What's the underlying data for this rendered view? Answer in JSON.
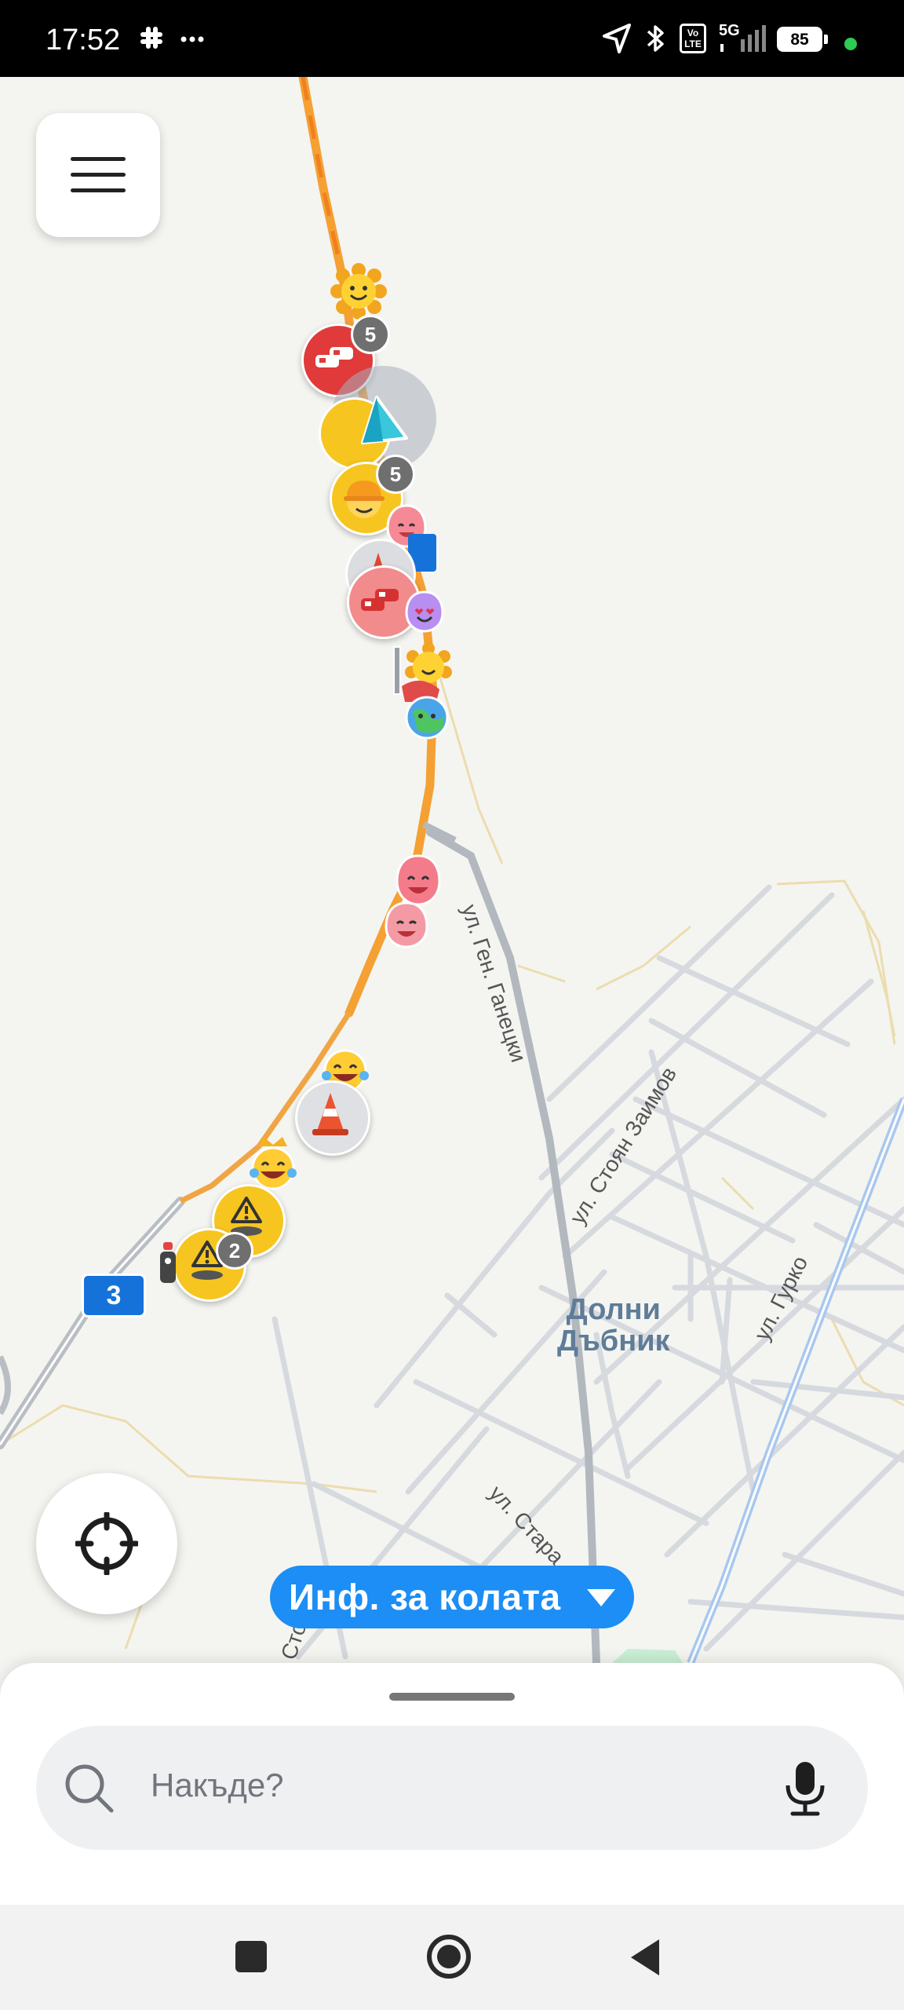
{
  "status_bar": {
    "time": "17:52",
    "battery": "85",
    "network": "5G",
    "volte": "Vo LTE",
    "icons": [
      "slack-icon",
      "more-icon",
      "location-arrow-icon",
      "bluetooth-icon",
      "volte-icon",
      "signal-icon",
      "battery-icon",
      "privacy-dot-icon"
    ]
  },
  "map": {
    "route_shield": "3",
    "town_line1": "Долни",
    "town_line2": "Дъбник",
    "streets": {
      "gen_ganetski": "ул. Ген. Ганецки",
      "stoyan_zaimov": "ул. Стоян Заимов",
      "gurko": "ул. Гурко",
      "stara": "ул. Стара",
      "stoyan_partial": "Стоян"
    },
    "badges": {
      "traffic_top": "5",
      "construction": "5",
      "hazard": "2"
    },
    "route_colors": {
      "traffic": "#f5a033",
      "road": "#d4d7dc",
      "highway": "#b9bec4",
      "accent": "#1c8ef5"
    }
  },
  "car_info": {
    "label": "Инф. за колата"
  },
  "search": {
    "placeholder": "Накъде?"
  },
  "nav_bar": {
    "icons": [
      "recent-apps-icon",
      "home-icon",
      "back-icon"
    ]
  }
}
